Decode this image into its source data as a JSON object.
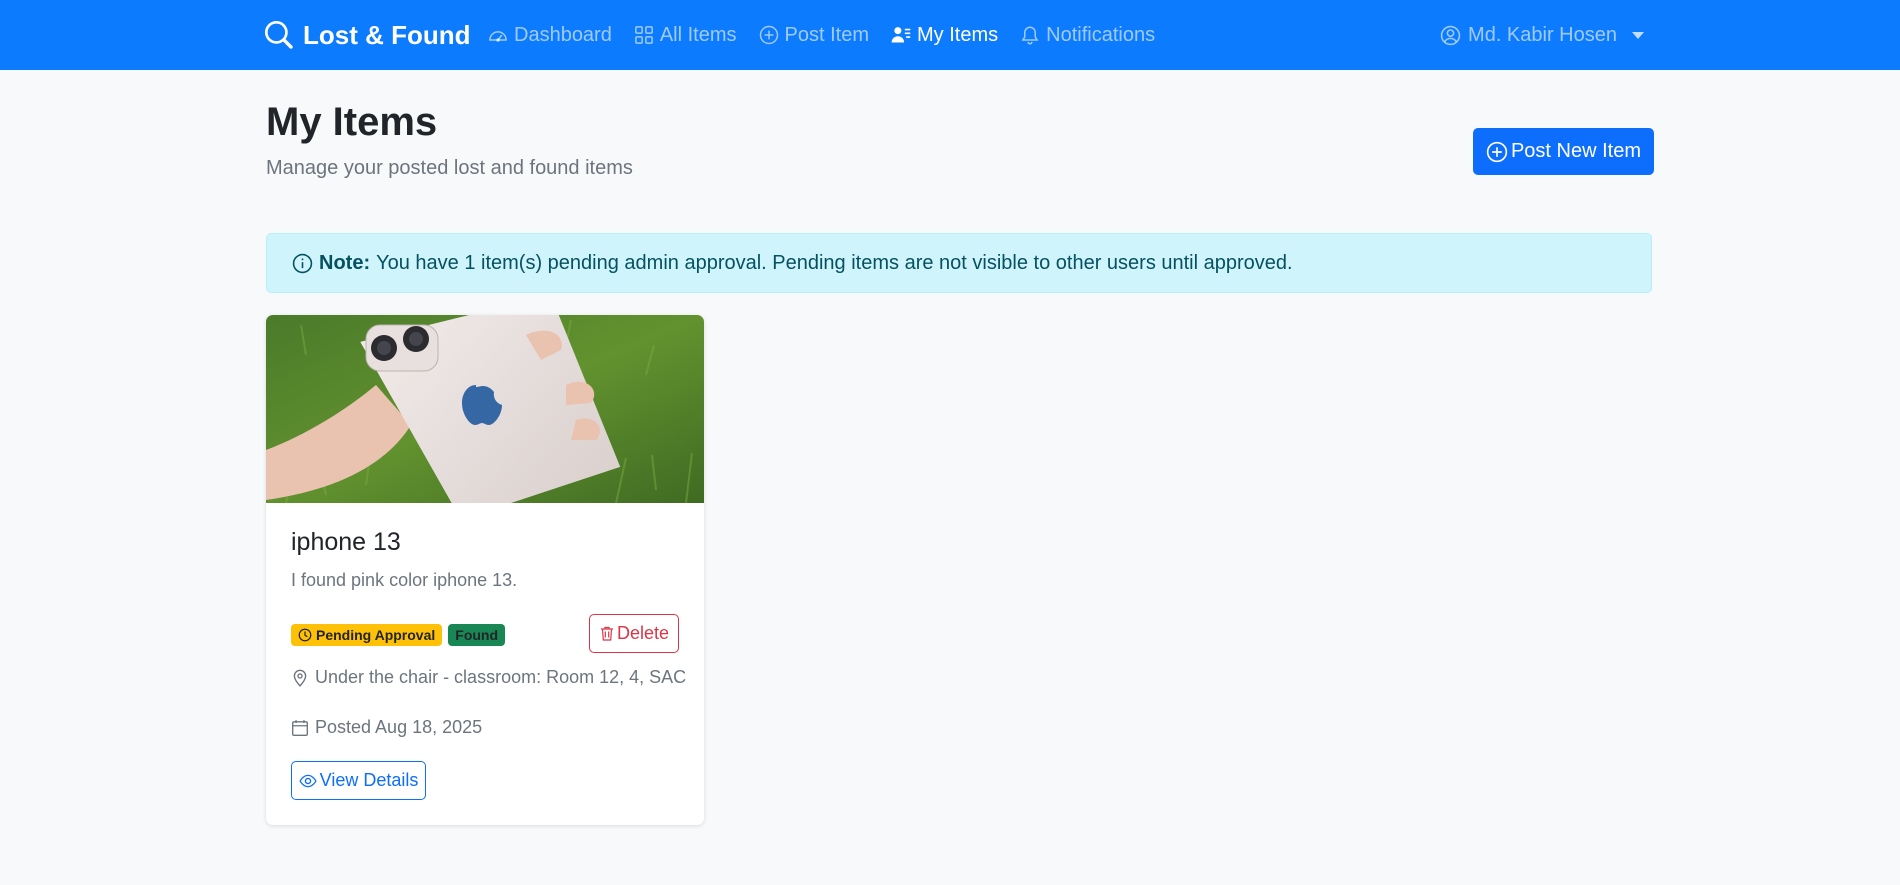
{
  "navbar": {
    "brand": "Lost & Found",
    "links": [
      {
        "label": "Dashboard",
        "icon": "speedometer-icon"
      },
      {
        "label": "All Items",
        "icon": "grid-icon"
      },
      {
        "label": "Post Item",
        "icon": "plus-circle-icon"
      },
      {
        "label": "My Items",
        "icon": "person-lines-icon",
        "active": true
      },
      {
        "label": "Notifications",
        "icon": "bell-icon"
      }
    ],
    "user": "Md. Kabir Hosen"
  },
  "header": {
    "title": "My Items",
    "subtitle": "Manage your posted lost and found items",
    "post_button": "Post New Item"
  },
  "alert": {
    "label": "Note:",
    "text": "You have 1 item(s) pending admin approval. Pending items are not visible to other users until approved."
  },
  "items": [
    {
      "title": "iphone 13",
      "description": "I found pink color iphone 13.",
      "status_badge": "Pending Approval",
      "type_badge": "Found",
      "delete_label": "Delete",
      "location": "Under the chair - classroom: Room 12, 4, SAC",
      "posted": "Posted Aug 18, 2025",
      "view_label": "View Details"
    }
  ],
  "colors": {
    "primary": "#0d6efd",
    "navbar": "#0d7bfd",
    "danger": "#dc3545",
    "warning": "#ffc107",
    "success": "#198754",
    "info_bg": "#cff4fc"
  }
}
